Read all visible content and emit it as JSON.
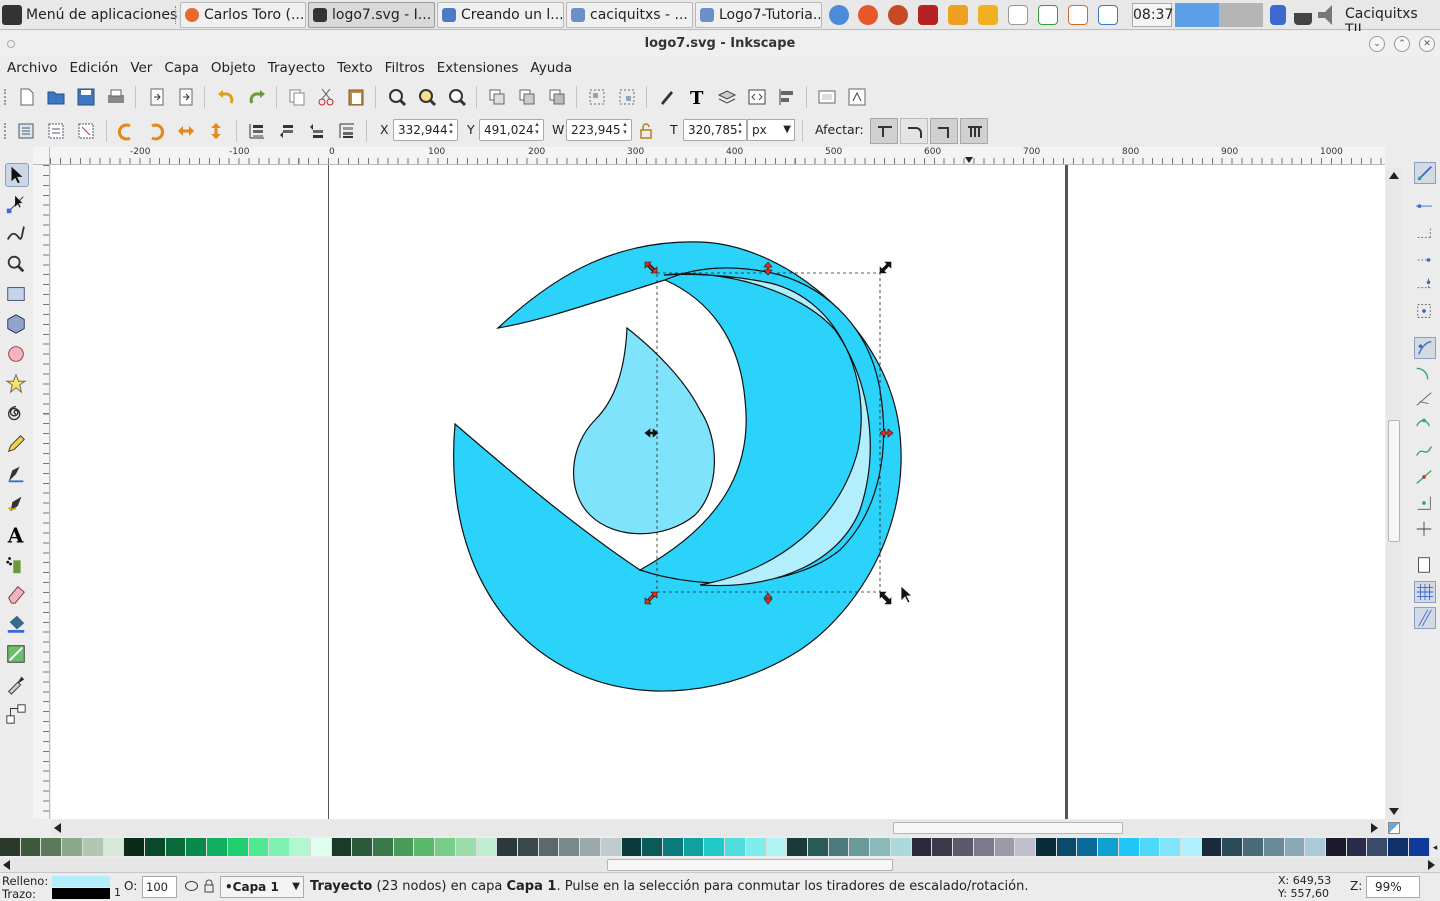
{
  "taskbar": {
    "start_label": "Menú de aplicaciones",
    "tasks": [
      {
        "label": "Carlos Toro (..."
      },
      {
        "label": "logo7.svg - I..."
      },
      {
        "label": "Creando un l..."
      },
      {
        "label": "caciquitxs - ..."
      },
      {
        "label": "Logo7-Tutoria..."
      }
    ],
    "clock": "08:37",
    "user": "Caciquitxs TIL"
  },
  "window": {
    "title": "logo7.svg - Inkscape"
  },
  "menu": [
    "Archivo",
    "Edición",
    "Ver",
    "Capa",
    "Objeto",
    "Trayecto",
    "Texto",
    "Filtros",
    "Extensiones",
    "Ayuda"
  ],
  "toolcontrols": {
    "x_label": "X",
    "x_value": "332,944",
    "y_label": "Y",
    "y_value": "491,024",
    "w_label": "W",
    "w_value": "223,945",
    "h_label": "T",
    "h_value": "320,785",
    "unit": "px",
    "affect_label": "Afectar:"
  },
  "ruler": {
    "h_ticks": [
      "-200",
      "-100",
      "0",
      "100",
      "200",
      "300",
      "400",
      "500",
      "600",
      "700",
      "800",
      "900",
      "1000"
    ]
  },
  "status": {
    "fill_label": "Relleno:",
    "stroke_label": "Trazo:",
    "stroke_width": "1",
    "opacity_label": "O:",
    "opacity_value": "100",
    "layer": "•Capa 1",
    "message_bold": "Trayecto",
    "message_1": " (23 nodos) en capa ",
    "message_layer": "Capa 1",
    "message_2": ". Pulse en la selección para conmutar los tiradores de escalado/rotación.",
    "cursor_x": "X: 649,53",
    "cursor_y": "Y: 557,60",
    "zoom_label": "Z:",
    "zoom_value": "99%"
  },
  "colors": {
    "shape_fill": "#2bd3fb",
    "drop_fill": "#7fe3fb",
    "inner_fill": "#b2eefc",
    "handle": "#e0301e"
  }
}
